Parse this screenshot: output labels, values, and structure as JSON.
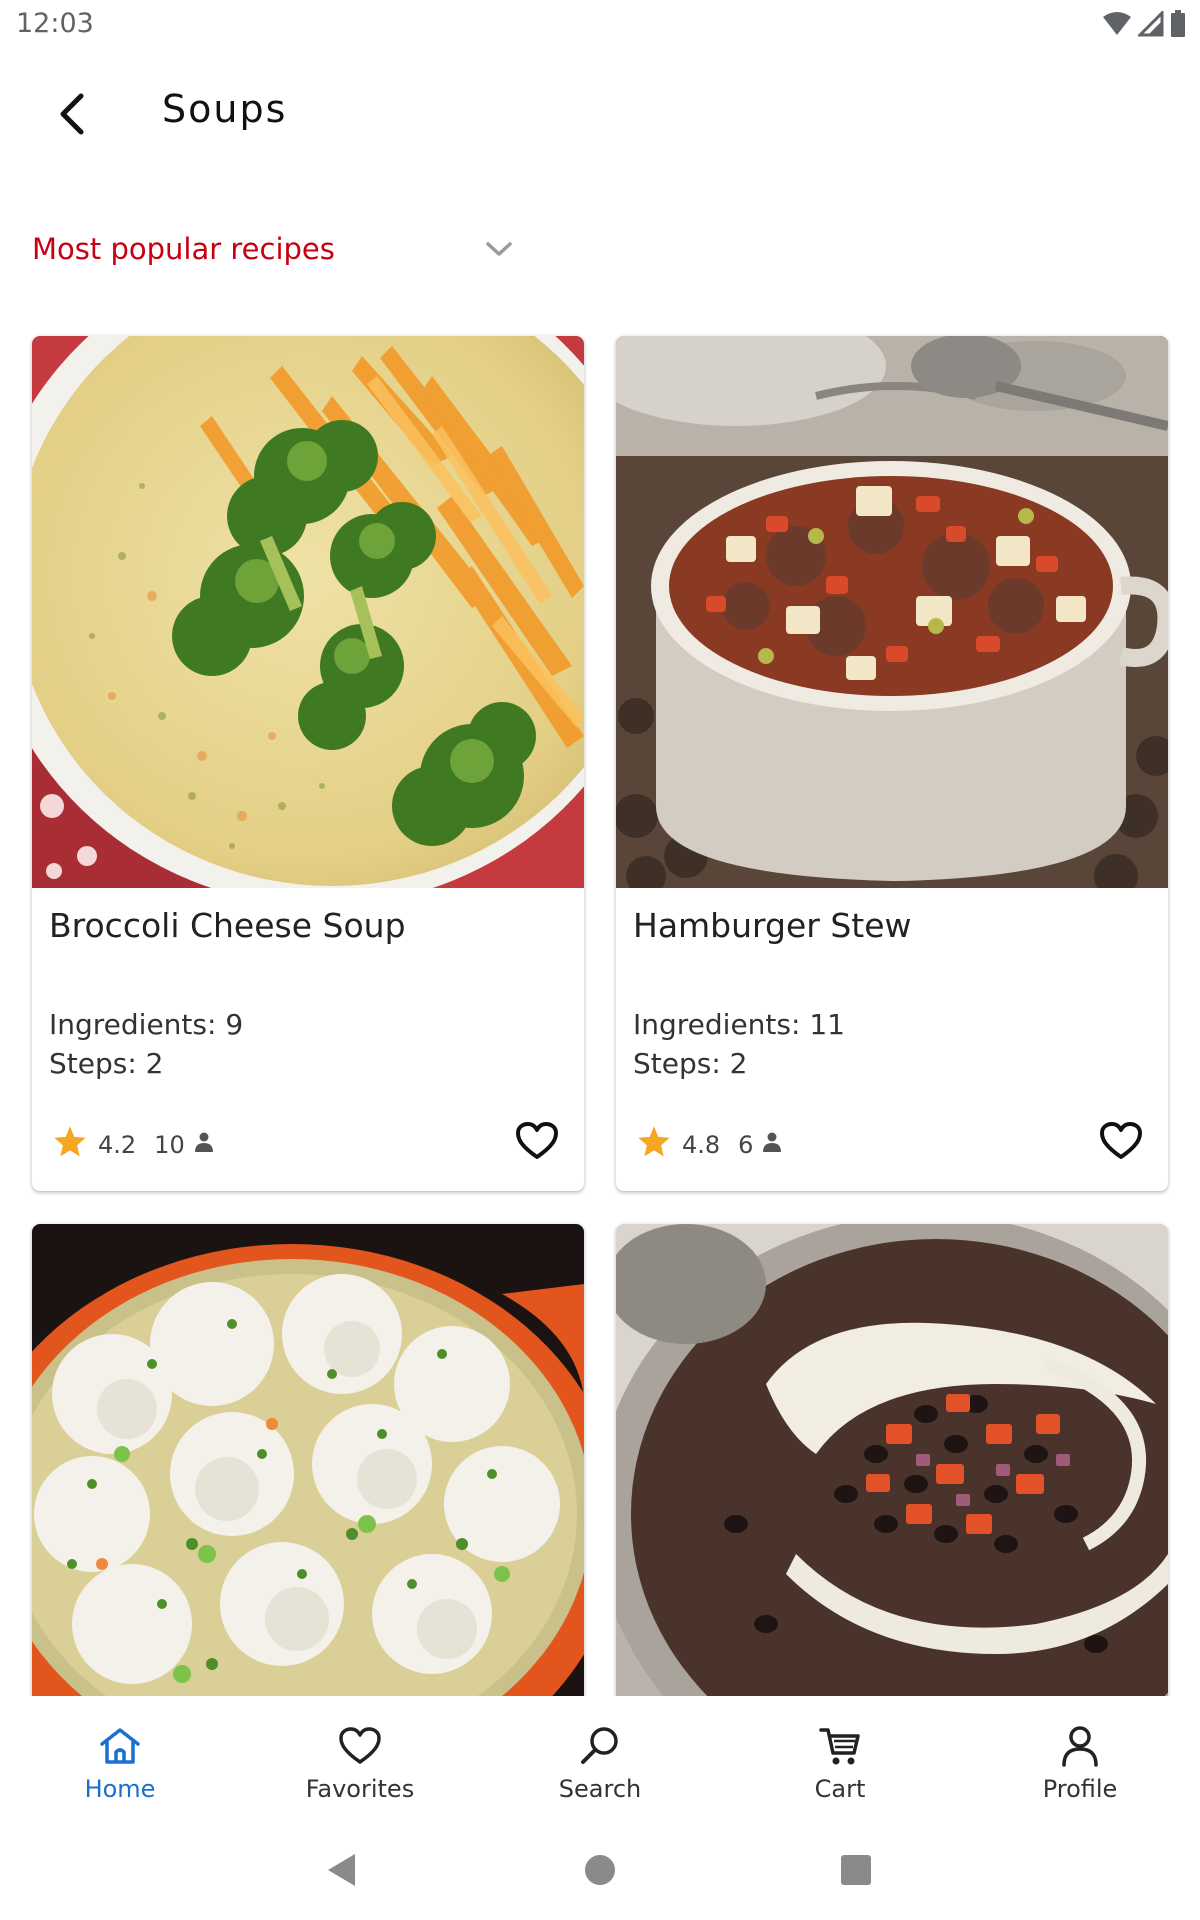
{
  "status_bar": {
    "time": "12:03",
    "icons": [
      "wifi-icon",
      "cell-signal-icon",
      "battery-icon"
    ]
  },
  "app_bar": {
    "back_icon": "back-arrow-icon",
    "title": "Soups"
  },
  "filter": {
    "selected": "Most popular recipes",
    "icon": "chevron-down-icon",
    "color": "#c8000f"
  },
  "recipes": [
    {
      "title": "Broccoli Cheese Soup",
      "ingredients": "Ingredients: 9",
      "steps": "Steps: 2",
      "rating": "4.2",
      "reviews": "10",
      "image": "broccoli-cheese-soup-photo"
    },
    {
      "title": "Hamburger Stew",
      "ingredients": "Ingredients: 11",
      "steps": "Steps: 2",
      "rating": "4.8",
      "reviews": "6",
      "image": "hamburger-stew-photo"
    },
    {
      "title": "",
      "image": "dumplings-stew-photo"
    },
    {
      "title": "",
      "image": "black-bean-soup-photo"
    }
  ],
  "bottom_nav": {
    "items": [
      {
        "label": "Home",
        "icon": "home-icon",
        "active": true
      },
      {
        "label": "Favorites",
        "icon": "heart-outline-icon",
        "active": false
      },
      {
        "label": "Search",
        "icon": "search-icon",
        "active": false
      },
      {
        "label": "Cart",
        "icon": "cart-icon",
        "active": false
      },
      {
        "label": "Profile",
        "icon": "person-icon",
        "active": false
      }
    ],
    "active_color": "#1a6fd1"
  },
  "system_nav": {
    "icons": [
      "back-triangle-icon",
      "home-circle-icon",
      "recents-square-icon"
    ]
  },
  "colors": {
    "accent_red": "#c8000f",
    "star": "#f5a623",
    "nav_active": "#1a6fd1"
  }
}
